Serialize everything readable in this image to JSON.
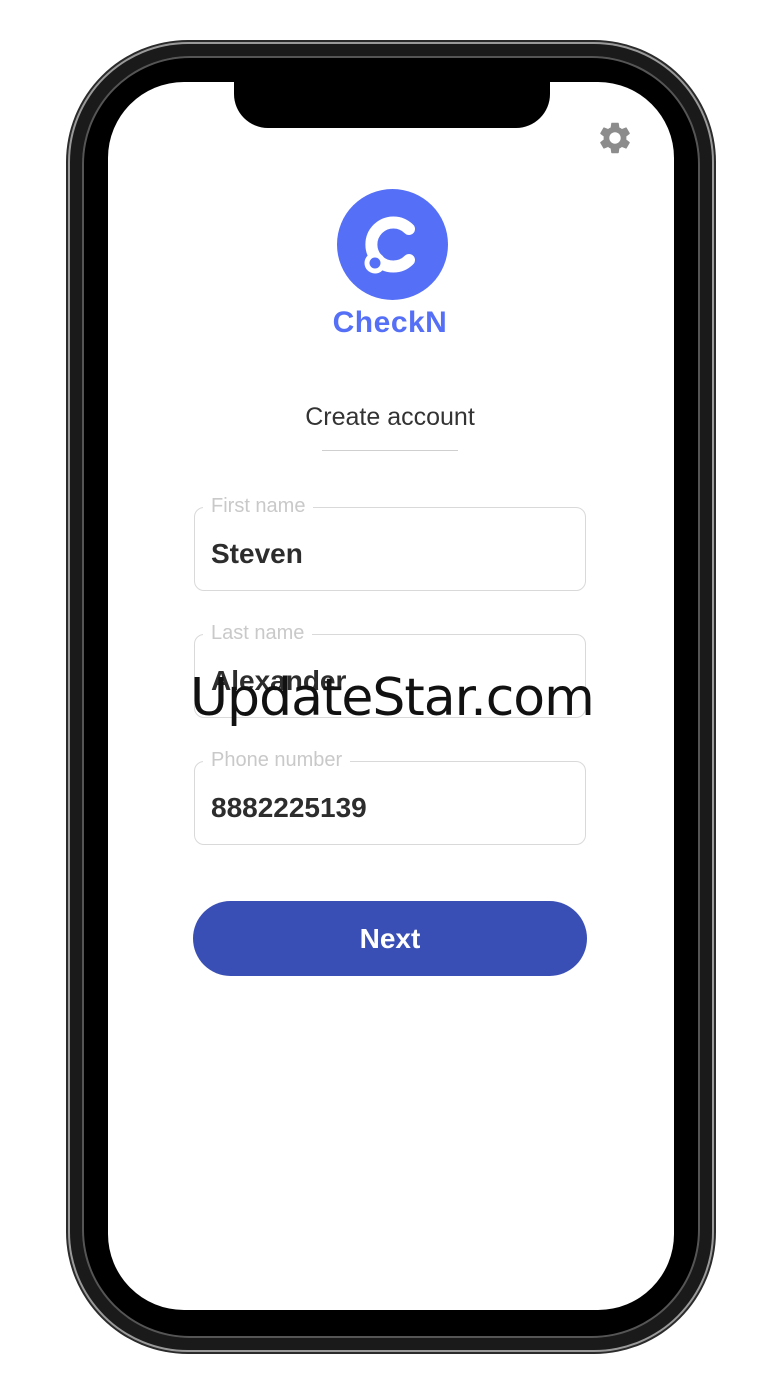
{
  "app": {
    "brand_name": "CheckN",
    "brand_color": "#5570f6",
    "settings_icon": "gear-icon"
  },
  "page": {
    "title": "Create account"
  },
  "form": {
    "first_name": {
      "label": "First name",
      "value": "Steven"
    },
    "last_name": {
      "label": "Last name",
      "value": "Alexander"
    },
    "phone": {
      "label": "Phone number",
      "value": "8882225139"
    }
  },
  "actions": {
    "next_label": "Next",
    "next_color": "#3a4fb5"
  },
  "watermark": "UpdateStar.com"
}
